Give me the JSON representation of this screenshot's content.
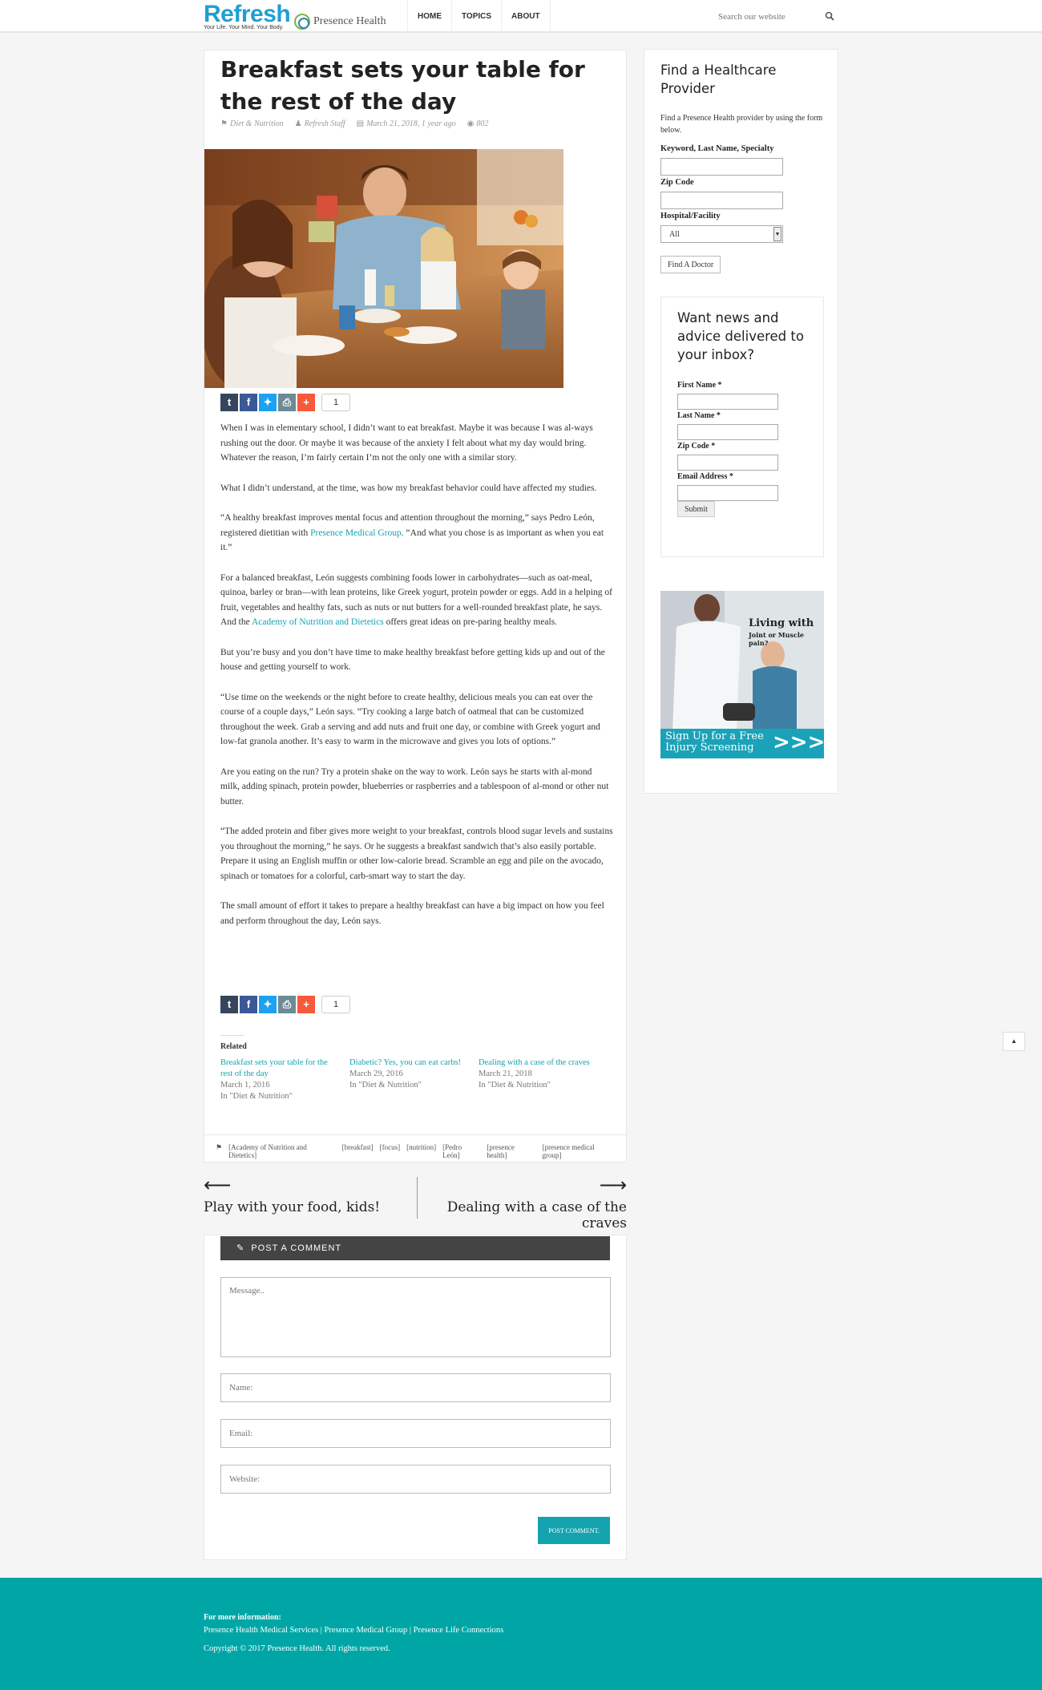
{
  "header": {
    "logo": "Refresh",
    "tagline": "Your Life. Your Mind. Your Body.",
    "partner": "Presence Health",
    "nav": [
      "HOME",
      "TOPICS",
      "ABOUT"
    ],
    "search_placeholder": "Search our website"
  },
  "article": {
    "title": "Breakfast sets your table for the rest of the day",
    "meta": {
      "category": "Diet & Nutrition",
      "author": "Refresh Staff",
      "date": "March 21, 2018, 1 year ago",
      "views": "802"
    },
    "share_count": "1",
    "paragraphs": [
      "When I was in elementary school, I didn’t want to eat breakfast. Maybe it was because I was al-ways rushing out the door. Or maybe it was because of the anxiety I felt about what my day would bring. Whatever the reason, I’m fairly certain I’m not the only one with a similar story.",
      "What I didn’t understand, at the time, was how my breakfast behavior could have affected my studies."
    ],
    "p3": {
      "before": "“A healthy breakfast improves mental focus and attention throughout the morning,” says Pedro León, registered dietitian with ",
      "link": "Presence Medical Group",
      "after": ". “And what you chose is as important as when you eat it.”"
    },
    "p4": {
      "before": "For a balanced breakfast, León suggests combining foods lower in carbohydrates—such as oat-meal, quinoa, barley or bran—with lean proteins, like Greek yogurt, protein powder or eggs. Add in a helping of fruit, vegetables and healthy fats, such as nuts or nut butters for a well-rounded breakfast plate, he says. And the ",
      "link": "Academy of Nutrition and Dietetics",
      "after": " offers great ideas on pre-paring healthy meals."
    },
    "more_paragraphs": [
      "But you’re busy and you don’t have time to make healthy breakfast before getting kids up and out of the house and getting yourself to work.",
      "“Use time on the weekends or the night before to create healthy, delicious meals you can eat over the course of a couple days,” León says. “Try cooking a large batch of oatmeal that can be customized throughout the week. Grab a serving and add nuts and fruit one day, or combine with Greek yogurt and low-fat granola another. It’s easy to warm in the microwave and gives you lots of options.”",
      "Are you eating on the run? Try a protein shake on the way to work. León says he starts with al-mond milk, adding spinach, protein powder, blueberries or raspberries and a tablespoon of al-mond or other nut butter.",
      "“The added protein and fiber gives more weight to your breakfast, controls blood sugar levels and sustains you throughout the morning,” he says. Or he suggests a breakfast sandwich that’s also easily portable. Prepare it using an English muffin or other low-calorie bread. Scramble an egg and pile on the avocado, spinach or tomatoes for a colorful, carb-smart way to start the day.",
      "The small amount of effort it takes to prepare a healthy breakfast can have a big impact on how you feel and perform throughout the day, León says."
    ],
    "related_label": "Related",
    "related": [
      {
        "title": "Breakfast sets your table for the rest of the day",
        "date": "March 1, 2016",
        "cat": "In \"Diet & Nutrition\""
      },
      {
        "title": "Diabetic? Yes, you can eat carbs!",
        "date": "March 29, 2016",
        "cat": "In \"Diet & Nutrition\""
      },
      {
        "title": "Dealing with a case of the craves",
        "date": "March 21, 2018",
        "cat": "In \"Diet & Nutrition\""
      }
    ],
    "tags": [
      "[Academy of Nutrition and Dietetics]",
      "[breakfast]",
      "[focus]",
      "[nutrition]",
      "[Pedro León]",
      "[presence health]",
      "[presence medical group]"
    ]
  },
  "postnav": {
    "prev": "Play with your food, kids!",
    "next": "Dealing with a case of the craves"
  },
  "comment": {
    "heading": "POST A COMMENT",
    "message_ph": "Message..",
    "name_ph": "Name:",
    "email_ph": "Email:",
    "website_ph": "Website:",
    "submit": "POST COMMENT."
  },
  "sidebar": {
    "title": "Find a Healthcare Provider",
    "desc": "Find a Presence Health provider by using the form below.",
    "label_keyword": "Keyword, Last Name, Specialty",
    "label_zip": "Zip Code",
    "label_hospital": "Hospital/Facility",
    "hospital_value": "All",
    "find_button": "Find A Doctor",
    "news": {
      "title": "Want news and advice delivered to your inbox?",
      "first_name": "First Name *",
      "last_name": "Last Name *",
      "zip": "Zip Code *",
      "email": "Email Address *",
      "submit": "Submit"
    },
    "ad": {
      "headline": "Living with",
      "sub": "Joint or Muscle pain?",
      "cta1": "Sign Up for a Free",
      "cta2": "Injury Screening"
    }
  },
  "footer": {
    "heading": "For more information:",
    "links": "Presence Health Medical Services | Presence Medical Group | Presence Life Connections",
    "copyright": "Copyright © 2017 Presence Health. All rights reserved."
  },
  "colors": {
    "accent": "#16a3b0",
    "footer": "#00a6a6",
    "tumblr": "#35465c",
    "facebook": "#3b5998",
    "twitter": "#1da1f2",
    "print": "#6d8a96",
    "more": "#f65a3b"
  }
}
